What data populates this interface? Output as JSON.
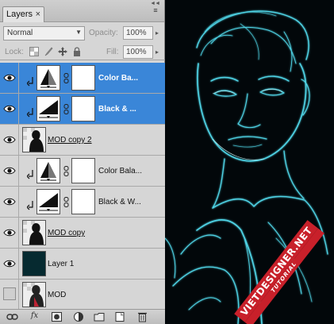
{
  "panel": {
    "tab_label": "Layers",
    "tab_close": "×",
    "collapse": "◄◄",
    "menu": "≡"
  },
  "options": {
    "blend_mode": "Normal",
    "opacity_label": "Opacity:",
    "opacity_value": "100%",
    "lock_label": "Lock:",
    "fill_label": "Fill:",
    "fill_value": "100%"
  },
  "layers": [
    {
      "name": "Color Ba...",
      "type": "color-balance",
      "selected": true,
      "visible": true,
      "clipped": true
    },
    {
      "name": "Black & ...",
      "type": "black-white",
      "selected": true,
      "visible": true,
      "clipped": true
    },
    {
      "name": "MOD copy 2",
      "type": "pixel",
      "selected": false,
      "visible": true,
      "clipped": false
    },
    {
      "name": "Color Bala...",
      "type": "color-balance",
      "selected": false,
      "visible": true,
      "clipped": true
    },
    {
      "name": "Black & W...",
      "type": "black-white",
      "selected": false,
      "visible": true,
      "clipped": true
    },
    {
      "name": "MOD copy",
      "type": "pixel",
      "selected": false,
      "visible": true,
      "clipped": false
    },
    {
      "name": "Layer 1",
      "type": "fill-dark",
      "selected": false,
      "visible": true,
      "clipped": false
    },
    {
      "name": "MOD",
      "type": "pixel",
      "selected": false,
      "visible": false,
      "clipped": false
    }
  ],
  "footer_icons": [
    "link-icon",
    "fx-icon",
    "add-mask-icon",
    "adjustment-icon",
    "folder-icon",
    "new-layer-icon",
    "trash-icon"
  ],
  "footer": {
    "fx": "fx"
  },
  "watermark": {
    "title": "VIETDESIGNER.NET",
    "subtitle": "TUTORIAL"
  },
  "colors": {
    "selection": "#3a86d8",
    "panel": "#d6d6d6",
    "glow": "#39c6d8"
  }
}
